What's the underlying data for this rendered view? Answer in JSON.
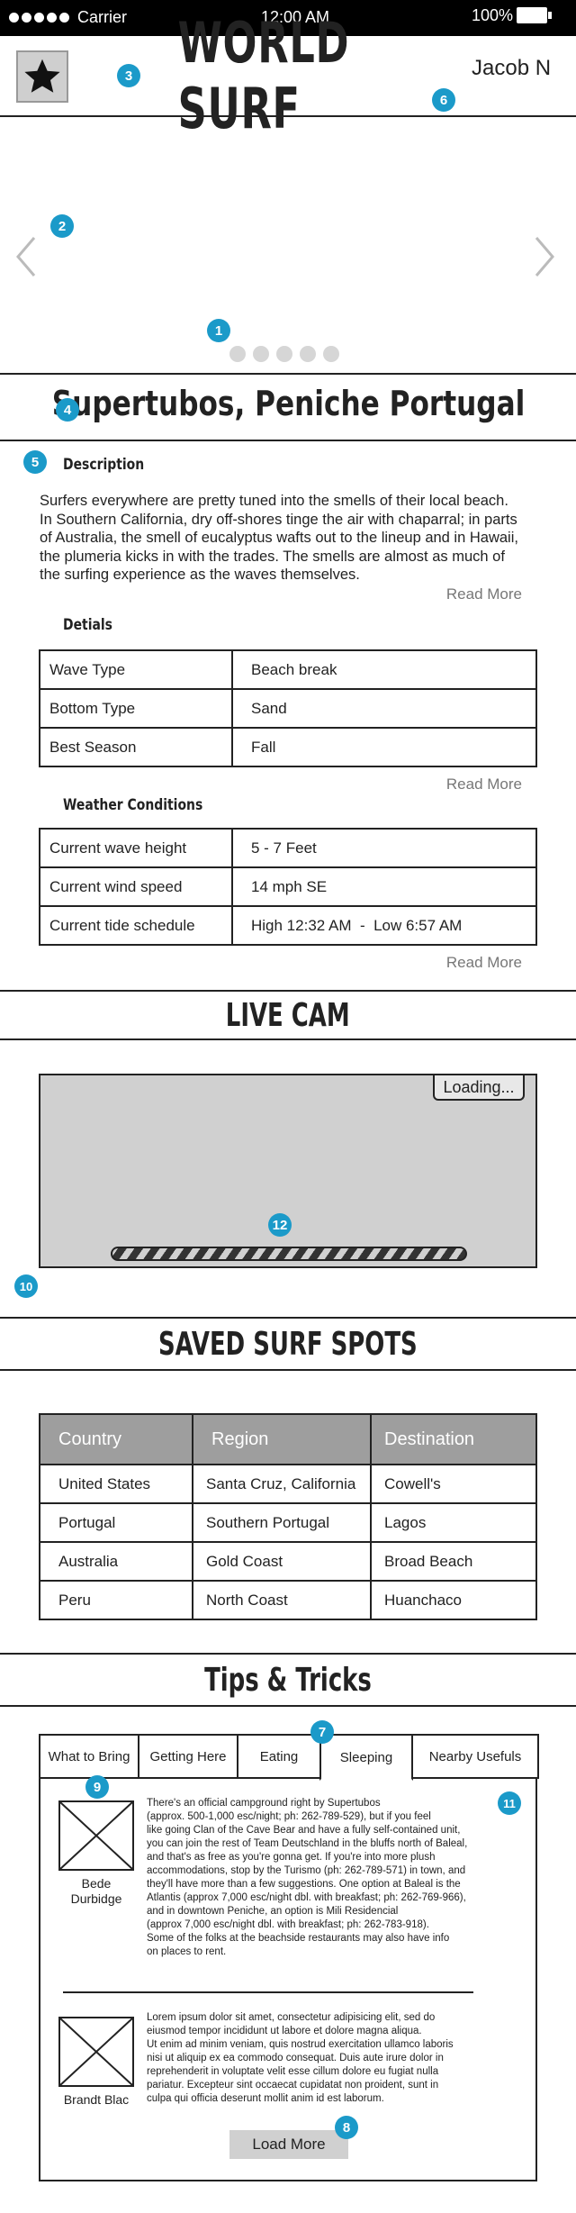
{
  "status_bar": {
    "carrier": "Carrier",
    "time": "12:00 AM",
    "battery": "100%"
  },
  "header": {
    "logo_icon": "star-icon",
    "title": "WORLD SURF",
    "user": "Jacob N"
  },
  "carousel": {
    "dots": 5,
    "active_dot": 0,
    "prev_icon": "chevron-left-icon",
    "next_icon": "chevron-right-icon"
  },
  "annotations": {
    "b1": "1",
    "b2": "2",
    "b3": "3",
    "b4": "4",
    "b5": "5",
    "b6": "6",
    "b7": "7",
    "b8": "8",
    "b9": "9",
    "b10": "10",
    "b11": "11",
    "b12": "12"
  },
  "spot": {
    "title": "Supertubos, Peniche Portugal"
  },
  "description": {
    "heading": "Description",
    "lines": [
      "Surfers everywhere are pretty tuned into the smells of their local beach.",
      "In Southern California, dry off-shores tinge the air with chaparral; in parts",
      "of Australia, the smell of eucalyptus wafts out to the lineup and in Hawaii,",
      "the plumeria kicks in with the trades. The smells are almost as much of",
      "the surfing experience as the waves themselves."
    ],
    "read_more": "Read More"
  },
  "details": {
    "heading": "Detials",
    "rows": [
      [
        "Wave Type",
        "Beach break"
      ],
      [
        "Bottom Type",
        "Sand"
      ],
      [
        "Best Season",
        "Fall"
      ]
    ],
    "read_more": "Read More"
  },
  "weather": {
    "heading": "Weather Conditions",
    "rows": [
      [
        "Current wave height",
        "5 - 7 Feet"
      ],
      [
        "Current wind speed",
        "14 mph SE"
      ],
      [
        "Current tide schedule",
        "High 12:32 AM  -  Low 6:57 AM"
      ]
    ],
    "read_more": "Read More"
  },
  "livecam": {
    "title": "LIVE CAM",
    "loading": "Loading..."
  },
  "saved": {
    "title": "SAVED SURF SPOTS",
    "headers": [
      "Country",
      "Region",
      "Destination"
    ],
    "rows": [
      [
        "United States",
        "Santa Cruz, California",
        "Cowell's"
      ],
      [
        "Portugal",
        "Southern Portugal",
        "Lagos"
      ],
      [
        "Australia",
        "Gold Coast",
        "Broad Beach"
      ],
      [
        "Peru",
        "North Coast",
        "Huanchaco"
      ]
    ]
  },
  "tips": {
    "title": "Tips & Tricks",
    "tabs": [
      "What to Bring",
      "Getting Here",
      "Eating",
      "Sleeping",
      "Nearby Usefuls"
    ],
    "active_tab": 3,
    "posts": [
      {
        "author_line1": "Bede",
        "author_line2": "Durbidge",
        "lines": [
          "There's an official campground right by Supertubos",
          "(approx. 500-1,000 esc/night; ph: 262-789-529), but if you feel",
          "like going Clan of the Cave Bear and have a fully self-contained unit,",
          "you can join the rest of Team Deutschland in the bluffs north of Baleal,",
          "and that's as free as you're gonna get. If you're into more plush",
          "accommodations, stop by the Turismo (ph: 262-789-571) in town, and",
          "they'll have more than a few suggestions. One option at Baleal is the",
          "Atlantis (approx 7,000 esc/night dbl. with breakfast; ph: 262-769-966),",
          "and in downtown Peniche, an option is Mili Residencial",
          "(approx 7,000 esc/night dbl. with breakfast; ph: 262-783-918).",
          "Some of the folks at the beachside restaurants may also have info",
          "on places to rent."
        ]
      },
      {
        "author_line1": "Brandt Blac",
        "author_line2": "",
        "lines": [
          "Lorem ipsum dolor sit amet, consectetur adipisicing elit, sed do",
          "eiusmod tempor incididunt ut labore et dolore magna aliqua.",
          "Ut enim ad minim veniam, quis nostrud exercitation ullamco laboris",
          "nisi ut aliquip ex ea commodo consequat. Duis aute irure dolor in",
          "reprehenderit in voluptate velit esse cillum dolore eu fugiat nulla",
          "pariatur. Excepteur sint occaecat cupidatat non proident, sunt in",
          "culpa qui officia deserunt mollit anim id est laborum."
        ]
      }
    ],
    "load_more": "Load More"
  }
}
